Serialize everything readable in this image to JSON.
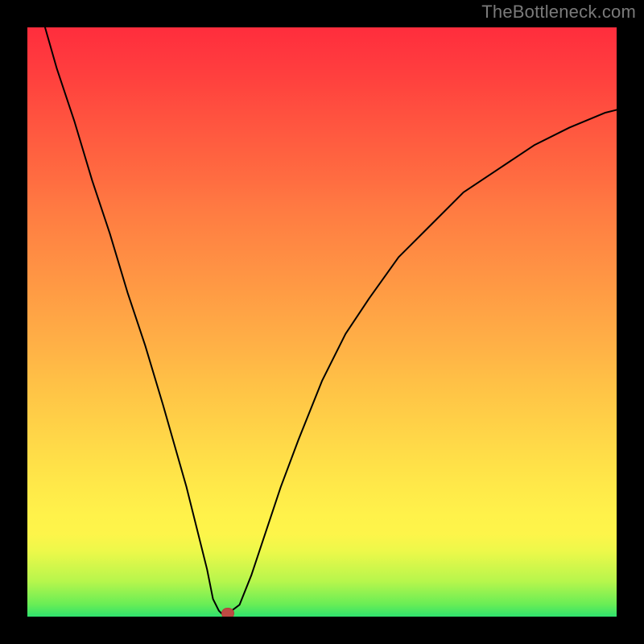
{
  "watermark": "TheBottleneck.com",
  "colors": {
    "background": "#000000",
    "gradient_top": "#ff2d3d",
    "gradient_mid": "#ffe949",
    "gradient_bottom": "#2fe26e",
    "curve": "#000000",
    "marker_fill": "#bd4a43",
    "marker_border": "#b53e38"
  },
  "chart_data": {
    "type": "line",
    "title": "",
    "xlabel": "",
    "ylabel": "",
    "xlim": [
      0,
      100
    ],
    "ylim": [
      0,
      100
    ],
    "grid": false,
    "legend": false,
    "x": [
      3,
      5,
      8,
      11,
      14,
      17,
      20,
      23,
      25,
      27,
      29,
      30.5,
      31.5,
      32.5,
      33,
      34,
      36,
      38,
      40,
      43,
      46,
      50,
      54,
      58,
      63,
      68,
      74,
      80,
      86,
      92,
      98,
      100
    ],
    "values": [
      100,
      93,
      84,
      74,
      65,
      55,
      46,
      36,
      29,
      22,
      14,
      8,
      3,
      1,
      0.5,
      0.5,
      2,
      7,
      13,
      22,
      30,
      40,
      48,
      54,
      61,
      66,
      72,
      76,
      80,
      83,
      85.5,
      86
    ],
    "marker": {
      "x": 34,
      "y": 0.5
    },
    "note": "Values are percentages of chart height from bottom; x is percentage from left. Estimated from pixels."
  }
}
